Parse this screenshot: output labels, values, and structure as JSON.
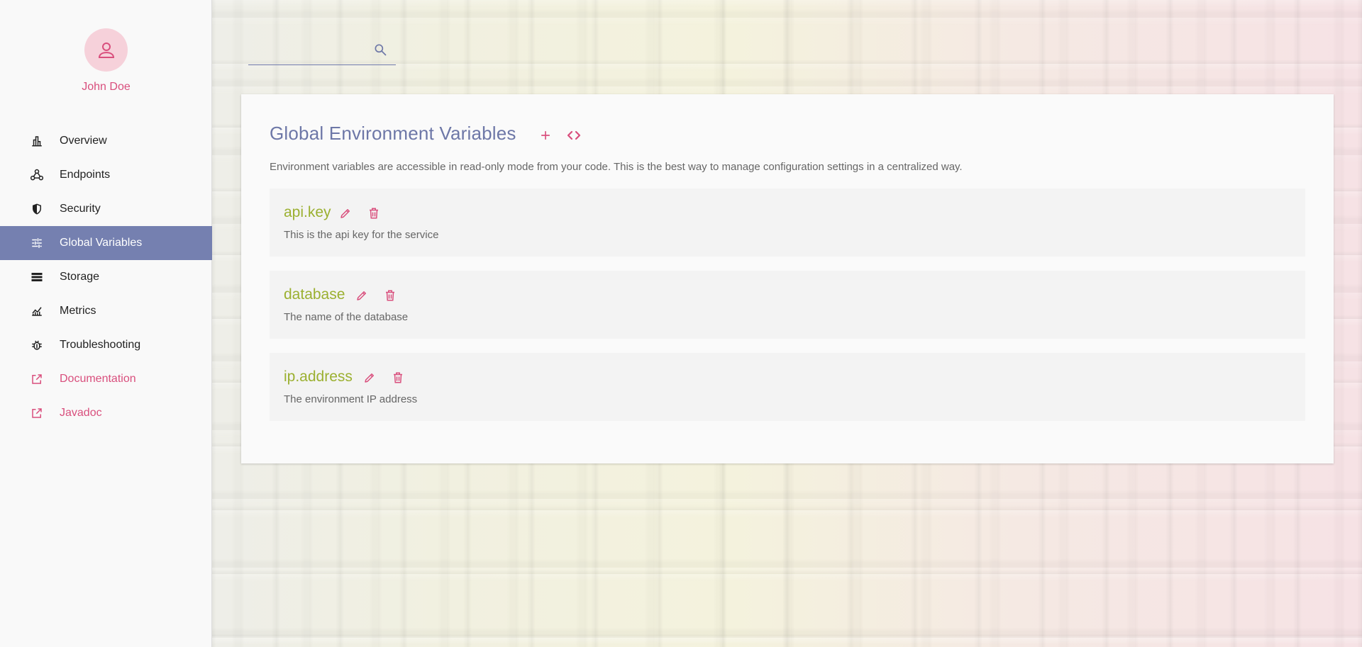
{
  "user": {
    "name": "John Doe",
    "avatar_icon": "user-icon"
  },
  "colors": {
    "accent": "#d94f7d",
    "primary": "#6d77a7",
    "active_nav": "#7580b0",
    "var_name": "#9bb030"
  },
  "nav": {
    "items": [
      {
        "label": "Overview",
        "icon": "bar-chart-icon",
        "active": false,
        "external": false
      },
      {
        "label": "Endpoints",
        "icon": "webhook-icon",
        "active": false,
        "external": false
      },
      {
        "label": "Security",
        "icon": "shield-icon",
        "active": false,
        "external": false
      },
      {
        "label": "Global Variables",
        "icon": "tune-icon",
        "active": true,
        "external": false
      },
      {
        "label": "Storage",
        "icon": "storage-icon",
        "active": false,
        "external": false
      },
      {
        "label": "Metrics",
        "icon": "metrics-icon",
        "active": false,
        "external": false
      },
      {
        "label": "Troubleshooting",
        "icon": "bug-icon",
        "active": false,
        "external": false
      },
      {
        "label": "Documentation",
        "icon": "external-link-icon",
        "active": false,
        "external": true
      },
      {
        "label": "Javadoc",
        "icon": "external-link-icon",
        "active": false,
        "external": true
      }
    ]
  },
  "search": {
    "value": "",
    "placeholder": ""
  },
  "main": {
    "title": "Global Environment Variables",
    "add_icon": "plus-icon",
    "code_icon": "code-icon",
    "description": "Environment variables are accessible in read-only mode from your code. This is the best way to manage configuration settings in a centralized way.",
    "variables": [
      {
        "name": "api.key",
        "description": "This is the api key for the service"
      },
      {
        "name": "database",
        "description": "The name of the database"
      },
      {
        "name": "ip.address",
        "description": "The environment IP address"
      }
    ]
  }
}
